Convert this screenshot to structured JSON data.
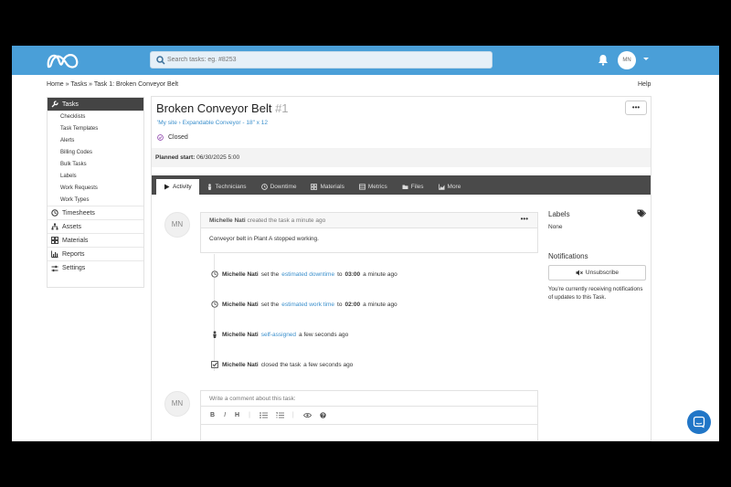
{
  "search": {
    "placeholder": "Search tasks: eg. #8253"
  },
  "user": {
    "initials": "MN"
  },
  "breadcrumb": {
    "text": "Home » Tasks » Task 1: Broken Conveyor Belt"
  },
  "help_label": "Help",
  "sidebar": {
    "tasks_label": "Tasks",
    "task_items": [
      "Checklists",
      "Task Templates",
      "Alerts",
      "Billing Codes",
      "Bulk Tasks",
      "Labels",
      "Work Requests",
      "Work Types"
    ],
    "timesheets_label": "Timesheets",
    "assets_label": "Assets",
    "materials_label": "Materials",
    "reports_label": "Reports",
    "settings_label": "Settings"
  },
  "task": {
    "title": "Broken Conveyor Belt",
    "number": "#1",
    "location": "'My site › Expandable Conveyor - 18\" x 12",
    "status": "Closed",
    "planned_label": "Planned start:",
    "planned_value": "06/30/2025 5:00",
    "more_button": "•••"
  },
  "tabs": [
    "Activity",
    "Technicians",
    "Downtime",
    "Materials",
    "Metrics",
    "Files",
    "More"
  ],
  "activity": {
    "comment": {
      "author": "Michelle Nati",
      "action": "created the task a minute ago",
      "body": "Conveyor belt in Plant A stopped working.",
      "menu": "•••"
    },
    "events": [
      {
        "author": "Michelle Nati",
        "pre": "set the",
        "link": "estimated downtime",
        "post": "to",
        "value": "03:00",
        "time": "a minute ago"
      },
      {
        "author": "Michelle Nati",
        "pre": "set the",
        "link": "estimated work time",
        "post": "to",
        "value": "02:00",
        "time": "a minute ago"
      },
      {
        "author": "Michelle Nati",
        "pre": "",
        "link": "self-assigned",
        "post": "",
        "value": "",
        "time": "a few seconds ago"
      },
      {
        "author": "Michelle Nati",
        "pre": "closed the task",
        "link": "",
        "post": "",
        "value": "",
        "time": "a few seconds ago"
      }
    ],
    "write_placeholder": "Write a comment about this task:",
    "toolbar": [
      "B",
      "I",
      "H"
    ]
  },
  "right_panel": {
    "labels_title": "Labels",
    "labels_value": "None",
    "notifications_title": "Notifications",
    "unsubscribe_label": "Unsubscribe",
    "notification_text": "You're currently receiving notifications of updates to this Task."
  },
  "colors": {
    "topbar": "#4a9fd8",
    "link": "#3a8fcc",
    "tabbar": "#4a4a4a",
    "chat": "#2176c7",
    "status": "#9b59b6"
  }
}
